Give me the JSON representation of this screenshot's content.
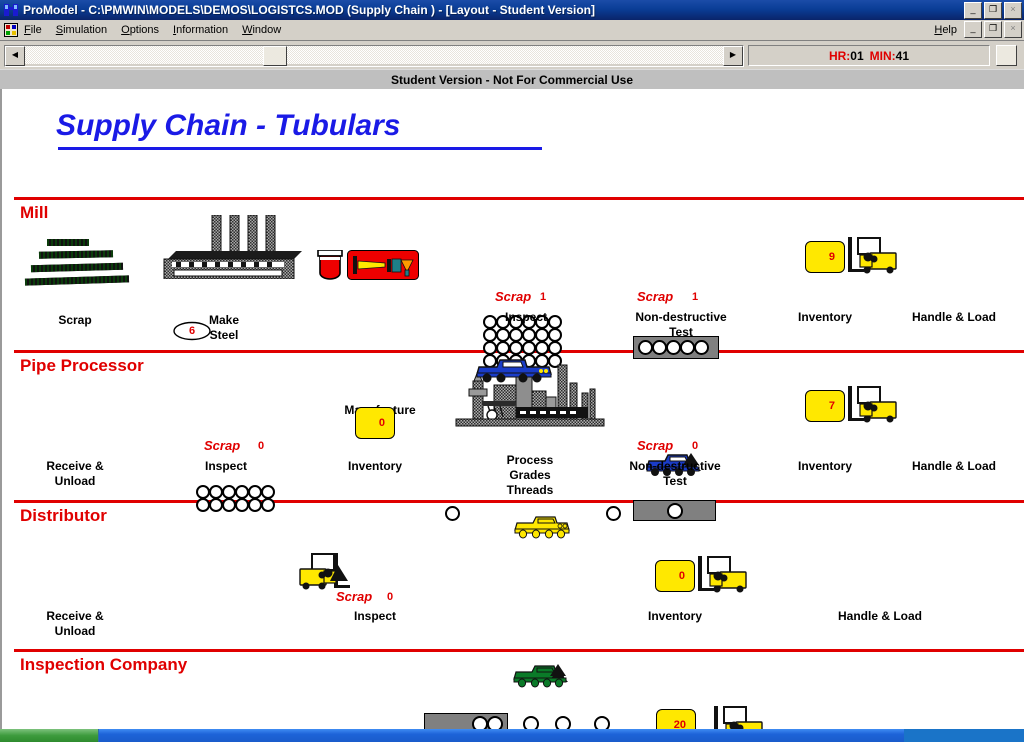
{
  "window": {
    "title": "ProModel - C:\\PMWIN\\MODELS\\DEMOS\\LOGISTCS.MOD (Supply Chain ) - [Layout - Student Version]",
    "app_icon": "promodel-icon",
    "controls": {
      "minimize": "_",
      "restore": "❐",
      "close": "×"
    },
    "mdi_controls": {
      "minimize": "_",
      "restore": "❐",
      "close": "×"
    }
  },
  "menu": {
    "app_icon": "document-icon",
    "items": [
      {
        "label": "File",
        "accel": "F"
      },
      {
        "label": "Simulation",
        "accel": "S"
      },
      {
        "label": "Options",
        "accel": "O"
      },
      {
        "label": "Information",
        "accel": "I"
      },
      {
        "label": "Window",
        "accel": "W"
      }
    ],
    "help_label": "Help",
    "help_accel": "H"
  },
  "toolstrip": {
    "scroll_left_icon": "triangle-left-icon",
    "scroll_right_icon": "triangle-right-icon",
    "clock": {
      "hr_label": "HR:",
      "hr_value": "01",
      "min_label": "MIN:",
      "min_value": "41"
    }
  },
  "banner": {
    "text": "Student Version - Not For Commercial Use"
  },
  "layout": {
    "title": "Supply Chain - Tubulars",
    "title_color": "#1a1ae6",
    "section_color": "#e00000",
    "sections": [
      {
        "name": "Mill",
        "stations": [
          {
            "label": "Scrap",
            "icon": "scrap-pile-icon"
          },
          {
            "label": "Make\nSteel",
            "icon": "furnace-icon",
            "badge": "6"
          },
          {
            "label": "Manufacture\nPipe",
            "icon": "crucible-and-press-icon"
          },
          {
            "label": "Inspect",
            "icon": "pipe-stack-icon",
            "scrap_label": "Scrap",
            "scrap_value": "1"
          },
          {
            "label": "Non-destructive\nTest",
            "icon": "ndt-bar-icon",
            "scrap_label": "Scrap",
            "scrap_value": "1"
          },
          {
            "label": "Inventory",
            "icon": "inventory-box-icon",
            "count": "9"
          },
          {
            "label": "Handle & Load",
            "icon": "forklift-icon"
          }
        ]
      },
      {
        "name": "Pipe Processor",
        "stations": [
          {
            "label": "Receive &\nUnload",
            "icon": "none"
          },
          {
            "label": "Inspect",
            "icon": "pipe-stack-icon",
            "scrap_label": "Scrap",
            "scrap_value": "0"
          },
          {
            "label": "Inventory",
            "icon": "inventory-box-icon",
            "count": "0"
          },
          {
            "label": "Process\nGrades\nThreads",
            "icon": "factory-icon"
          },
          {
            "label": "Non-destructive\nTest",
            "icon": "ndt-bar-icon",
            "scrap_label": "Scrap",
            "scrap_value": "0"
          },
          {
            "label": "Inventory",
            "icon": "inventory-box-icon",
            "count": "7"
          },
          {
            "label": "Handle & Load",
            "icon": "forklift-icon"
          }
        ]
      },
      {
        "name": "Distributor",
        "stations": [
          {
            "label": "Receive &\nUnload",
            "icon": "none"
          },
          {
            "label": "Inspect",
            "icon": "forklift-reverse-icon",
            "scrap_label": "Scrap",
            "scrap_value": "0"
          },
          {
            "label": "Inventory",
            "icon": "inventory-box-icon",
            "count": "0"
          },
          {
            "label": "Handle & Load",
            "icon": "none"
          }
        ],
        "vehicle": "yellow-truck-icon"
      },
      {
        "name": "Inspection Company",
        "stations": [
          {
            "label": "",
            "icon": "ndt-bar-icon"
          },
          {
            "label": "",
            "icon": "inventory-box-icon",
            "count": "20"
          },
          {
            "label": "",
            "icon": "forklift-icon"
          }
        ],
        "vehicle": "green-truck-icon"
      }
    ],
    "vehicles": [
      {
        "name": "blue-truck-icon",
        "color": "#1a3cc8"
      },
      {
        "name": "blue-truck-loaded-icon",
        "color": "#1a3cc8"
      },
      {
        "name": "yellow-truck-icon",
        "color": "#ffe800"
      },
      {
        "name": "green-truck-icon",
        "color": "#0a7a28"
      }
    ]
  }
}
